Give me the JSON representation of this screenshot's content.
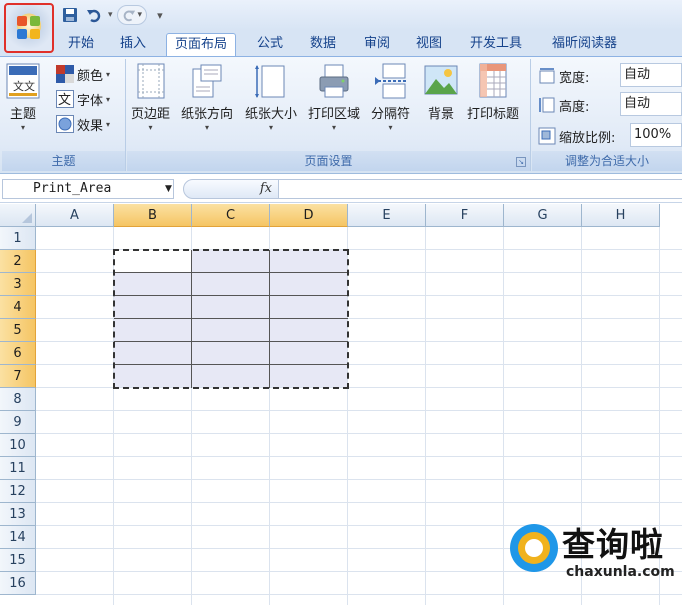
{
  "tabs": [
    "开始",
    "插入",
    "页面布局",
    "公式",
    "数据",
    "审阅",
    "视图",
    "开发工具",
    "福昕阅读器"
  ],
  "active_tab": "页面布局",
  "ribbon": {
    "themes": {
      "theme_label": "主题",
      "colors_label": "颜色",
      "fonts_label": "字体",
      "effects_label": "效果",
      "group_label": "主题"
    },
    "page_setup": {
      "margins_label": "页边距",
      "orientation_label": "纸张方向",
      "size_label": "纸张大小",
      "print_area_label": "打印区域",
      "breaks_label": "分隔符",
      "background_label": "背景",
      "print_titles_label": "打印标题",
      "group_label": "页面设置"
    },
    "scale_to_fit": {
      "width_label": "宽度:",
      "width_value": "自动",
      "height_label": "高度:",
      "height_value": "自动",
      "scale_label": "缩放比例:",
      "scale_value": "100%",
      "group_label": "调整为合适大小"
    }
  },
  "formula_bar": {
    "name_box": "Print_Area",
    "fx_label": "fx",
    "formula": ""
  },
  "columns": [
    "A",
    "B",
    "C",
    "D",
    "E",
    "F",
    "G",
    "H"
  ],
  "rows": [
    "1",
    "2",
    "3",
    "4",
    "5",
    "6",
    "7",
    "8",
    "9",
    "10",
    "11",
    "12",
    "13",
    "14",
    "15",
    "16"
  ],
  "selection": {
    "columns": [
      "B",
      "C",
      "D"
    ],
    "rows": [
      "2",
      "3",
      "4",
      "5",
      "6",
      "7"
    ]
  },
  "watermark": {
    "title": "查询啦",
    "url": "chaxunla.com"
  },
  "colors": {
    "ribbon_bg": "#dfe9f5",
    "tab_text": "#15428b",
    "selection_header": "#f5c564",
    "selection_fill": "#e7e8f5",
    "office_button_outline": "#e0302a"
  }
}
